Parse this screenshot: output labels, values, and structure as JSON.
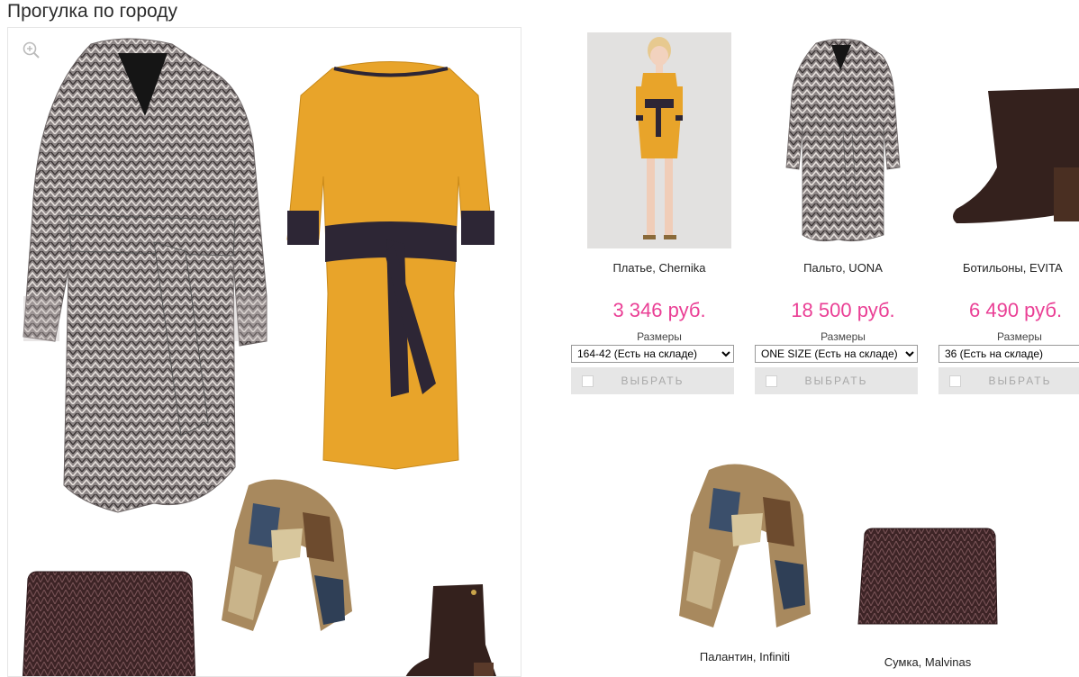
{
  "look": {
    "title": "Прогулка по городу",
    "zoom_icon": "zoom-in-icon"
  },
  "products": [
    {
      "name": "Платье, Chernika",
      "price": "3 346 руб.",
      "sizes_label": "Размеры",
      "selected_size": "164-42 (Есть на складе)",
      "button": "ВЫБРАТЬ"
    },
    {
      "name": "Пальто, UONA",
      "price": "18 500 руб.",
      "sizes_label": "Размеры",
      "selected_size": "ONE SIZE (Есть на складе)",
      "button": "ВЫБРАТЬ"
    },
    {
      "name": "Ботильоны, EVITA",
      "price": "6 490 руб.",
      "sizes_label": "Размеры",
      "selected_size": "36 (Есть на складе)",
      "button": "ВЫБРАТЬ"
    }
  ],
  "bottom_products": [
    {
      "name": "Палантин, Infiniti"
    },
    {
      "name": "Сумка, Malvinas"
    }
  ],
  "colors": {
    "price": "#ea3f95",
    "button_bg": "#e6e6e6",
    "button_text": "#a8a8a8"
  }
}
